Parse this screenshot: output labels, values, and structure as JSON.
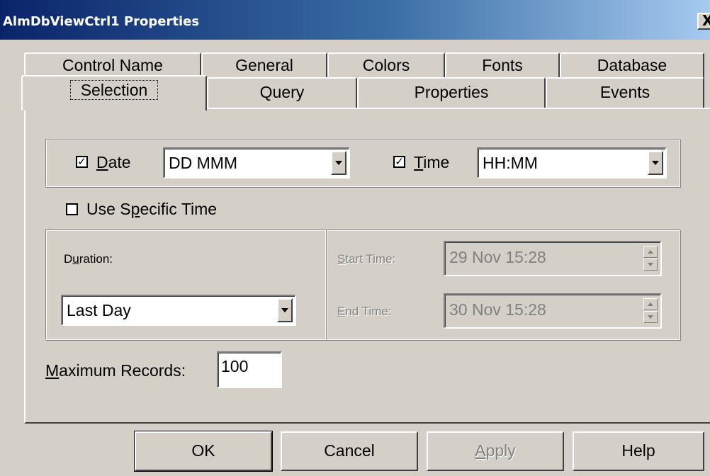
{
  "window": {
    "title": "AlmDbViewCtrl1 Properties",
    "close_glyph": "X"
  },
  "tabs": {
    "row1": [
      "Control Name",
      "General",
      "Colors",
      "Fonts",
      "Database"
    ],
    "row2": [
      "Selection",
      "Query",
      "Properties",
      "Events"
    ],
    "active": "Selection"
  },
  "format": {
    "date_label_key": "D",
    "date_label_rest": "ate",
    "date_checked": true,
    "date_value": "DD MMM",
    "time_label_key": "T",
    "time_label_rest": "ime",
    "time_checked": true,
    "time_value": "HH:MM"
  },
  "specific_time": {
    "label_pre": "Use S",
    "label_key": "p",
    "label_post": "ecific Time",
    "checked": false
  },
  "duration": {
    "label_pre": "D",
    "label_key": "u",
    "label_post": "ration:",
    "value": "Last Day"
  },
  "range": {
    "start_label_key": "S",
    "start_label_rest": "tart Time:",
    "start_value": "29 Nov 15:28",
    "end_label_key": "E",
    "end_label_rest": "nd Time:",
    "end_value": "30 Nov 15:28",
    "enabled": false
  },
  "max_records": {
    "label_key": "M",
    "label_rest": "aximum Records:",
    "value": "100"
  },
  "buttons": {
    "ok": "OK",
    "cancel": "Cancel",
    "apply_key": "A",
    "apply_rest": "pply",
    "help": "Help"
  },
  "colors": {
    "face": "#d4d0c8",
    "title_start": "#0a246a",
    "title_end": "#a6caf0",
    "disabled_text": "#808080"
  }
}
